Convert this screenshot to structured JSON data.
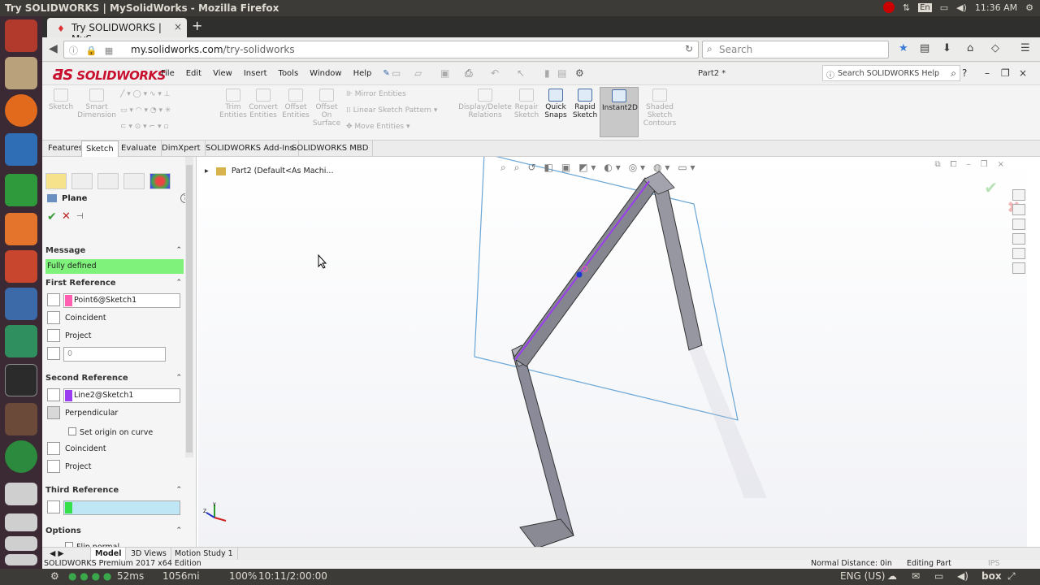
{
  "os": {
    "window_title": "Try SOLIDWORKS | MySolidWorks - Mozilla Firefox",
    "keyboard": "En",
    "clock": "11:36 AM",
    "launcher_icons": [
      "ubuntu-dash-icon",
      "files-icon",
      "firefox-icon",
      "writer-icon",
      "calc-icon",
      "software-center-icon",
      "settings-icon",
      "app-icon",
      "editor-icon",
      "terminal-icon",
      "paint-icon",
      "chrome-icon",
      "drive-icon",
      "drive-icon",
      "drive-icon",
      "drive-icon"
    ]
  },
  "browser": {
    "tab_title": "Try SOLIDWORKS | MyS",
    "url_host": "my.solidworks.com",
    "url_path": "/try-solidworks",
    "search_placeholder": "Search"
  },
  "sw": {
    "logo": "SOLIDWORKS",
    "menu": [
      "File",
      "Edit",
      "View",
      "Insert",
      "Tools",
      "Window",
      "Help"
    ],
    "doc_name": "Part2 *",
    "search_placeholder": "Search SOLIDWORKS Help",
    "commands": {
      "sketch": "Sketch",
      "smart_dimension": [
        "Smart",
        "Dimension"
      ],
      "trim": [
        "Trim",
        "Entities"
      ],
      "convert": [
        "Convert",
        "Entities"
      ],
      "offset": [
        "Offset",
        "Entities"
      ],
      "offset_surface": [
        "Offset",
        "On",
        "Surface"
      ],
      "mirror": "Mirror Entities",
      "linear_pattern": "Linear Sketch Pattern",
      "move": "Move Entities",
      "display_delete": [
        "Display/Delete",
        "Relations"
      ],
      "repair": [
        "Repair",
        "Sketch"
      ],
      "quick_snaps": [
        "Quick",
        "Snaps"
      ],
      "rapid_sketch": [
        "Rapid",
        "Sketch"
      ],
      "instant2d": "Instant2D",
      "shaded": [
        "Shaded",
        "Sketch",
        "Contours"
      ]
    },
    "cmd_tabs": [
      "Features",
      "Sketch",
      "Evaluate",
      "DimXpert",
      "SOLIDWORKS Add-Ins",
      "SOLIDWORKS MBD"
    ],
    "active_cmd_tab": "Sketch",
    "tree_root": "Part2  (Default<As Machi...",
    "pm": {
      "title": "Plane",
      "message_header": "Message",
      "message": "Fully defined",
      "first_ref_header": "First Reference",
      "first_ref_value": "Point6@Sketch1",
      "first_ref_color": "#ff5fb0",
      "coincident": "Coincident",
      "project": "Project",
      "distance": "0",
      "second_ref_header": "Second Reference",
      "second_ref_value": "Line2@Sketch1",
      "second_ref_color": "#9a3cf0",
      "perpendicular": "Perpendicular",
      "set_origin": "Set origin on curve",
      "coincident2": "Coincident",
      "project2": "Project",
      "third_ref_header": "Third Reference",
      "third_ref_color": "#35e04a",
      "options_header": "Options",
      "flip_normal": "Flip normal"
    },
    "bottom_tabs": [
      "Model",
      "3D Views",
      "Motion Study 1"
    ],
    "status": {
      "edition": "SOLIDWORKS Premium 2017 x64 Edition",
      "normal_distance": "Normal Distance: 0in",
      "mode": "Editing Part",
      "units": "IPS"
    }
  },
  "taskbar": {
    "ms": "52ms",
    "mi": "1056mi",
    "zoom": "100%",
    "time": "10:11/2:00:00",
    "lang": "ENG (US)",
    "box": "box"
  }
}
